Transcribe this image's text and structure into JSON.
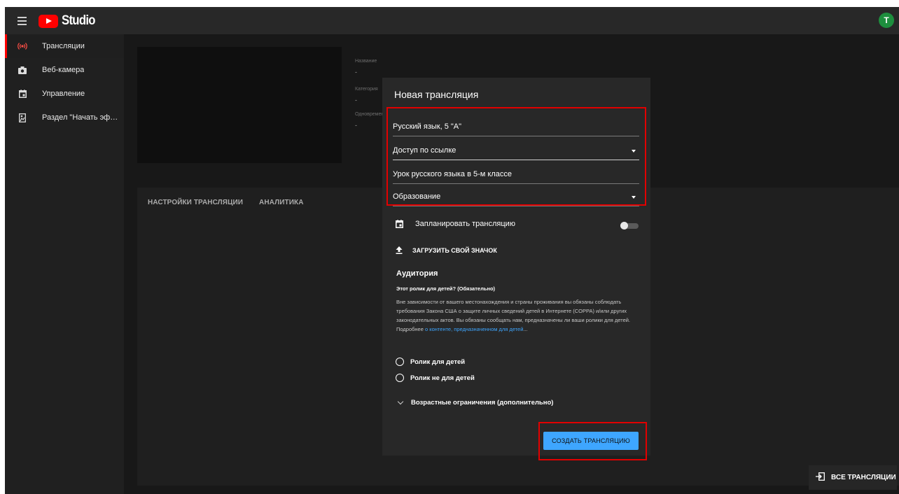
{
  "app": {
    "logo_text": "Studio",
    "avatar_letter": "T",
    "brand_color": "#ff0000",
    "accent_color": "#3ea6ff"
  },
  "sidebar": {
    "items": [
      {
        "label": "Трансляции",
        "icon": "live-broadcast-icon",
        "active": true
      },
      {
        "label": "Веб-камера",
        "icon": "camera-icon",
        "active": false
      },
      {
        "label": "Управление",
        "icon": "calendar-icon",
        "active": false
      },
      {
        "label": "Раздел \"Начать эфи...",
        "icon": "stream-start-icon",
        "active": false
      }
    ]
  },
  "stream_info": {
    "title_label": "Название",
    "title_value": "-",
    "category_label": "Категория",
    "category_value": "-",
    "simul_label": "Одновремен",
    "simul_value": "-"
  },
  "tabs": {
    "settings": "НАСТРОЙКИ ТРАНСЛЯЦИИ",
    "analytics": "АНАЛИТИКА"
  },
  "all_streams_button": "ВСЕ ТРАНСЛЯЦИИ",
  "dialog": {
    "title": "Новая трансляция",
    "name_value": "Русский язык, 5 \"А\"",
    "privacy_value": "Доступ по ссылке",
    "description_value": "Урок русского языка в 5-м классе",
    "category_value": "Образование",
    "schedule_label": "Запланировать трансляцию",
    "schedule_enabled": false,
    "upload_thumbnail": "ЗАГРУЗИТЬ СВОЙ ЗНАЧОК",
    "audience_title": "Аудитория",
    "audience_question": "Этот ролик для детей? (Обязательно)",
    "audience_desc": "Вне зависимости от вашего местонахождения и страны проживания вы обязаны соблюдать требования Закона США о защите личных сведений детей в Интернете (COPPA) и/или других законодательных актов. Вы обязаны сообщать нам, предназначены ли ваши ролики для детей. Подробнее ",
    "audience_link": "о контенте, предназначенном для детей",
    "audience_ellipsis": "...",
    "radio_kids": "Ролик для детей",
    "radio_not_kids": "Ролик не для детей",
    "age_restrictions": "Возрастные ограничения (дополнительно)",
    "create_button": "СОЗДАТЬ ТРАНСЛЯЦИЮ"
  }
}
